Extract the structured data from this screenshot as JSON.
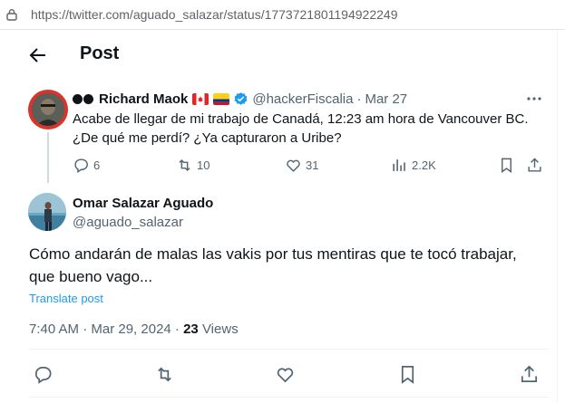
{
  "browser": {
    "url": "https://twitter.com/aguado_salazar/status/1773721801194922249"
  },
  "header": {
    "title": "Post"
  },
  "parent_tweet": {
    "name": "Richard Maok",
    "handle": "@hackerFiscalia",
    "separator": "·",
    "date": "Mar 27",
    "text": "Acabe de llegar de mi trabajo de Canadá, 12:23 am hora de Vancouver BC. ¿De qué me perdí? ¿Ya capturaron a Uribe?",
    "stats": {
      "replies": "6",
      "reposts": "10",
      "likes": "31",
      "views": "2.2K"
    }
  },
  "main_tweet": {
    "name": "Omar Salazar Aguado",
    "handle": "@aguado_salazar",
    "text": "Cómo andarán de malas las vakis por tus mentiras que te tocó trabajar, que bueno vago...",
    "translate": "Translate post",
    "time": "7:40 AM · Mar 29, 2024 · ",
    "views_count": "23",
    "views_label": " Views"
  },
  "colors": {
    "accent": "#1d9bf0",
    "text": "#0f1419",
    "muted": "#536471",
    "avatar_ring": "#d9342b"
  },
  "icons": [
    "lock-icon",
    "back-arrow-icon",
    "verified-badge-icon",
    "more-icon",
    "reply-icon",
    "repost-icon",
    "like-icon",
    "views-icon",
    "bookmark-icon",
    "share-icon"
  ]
}
